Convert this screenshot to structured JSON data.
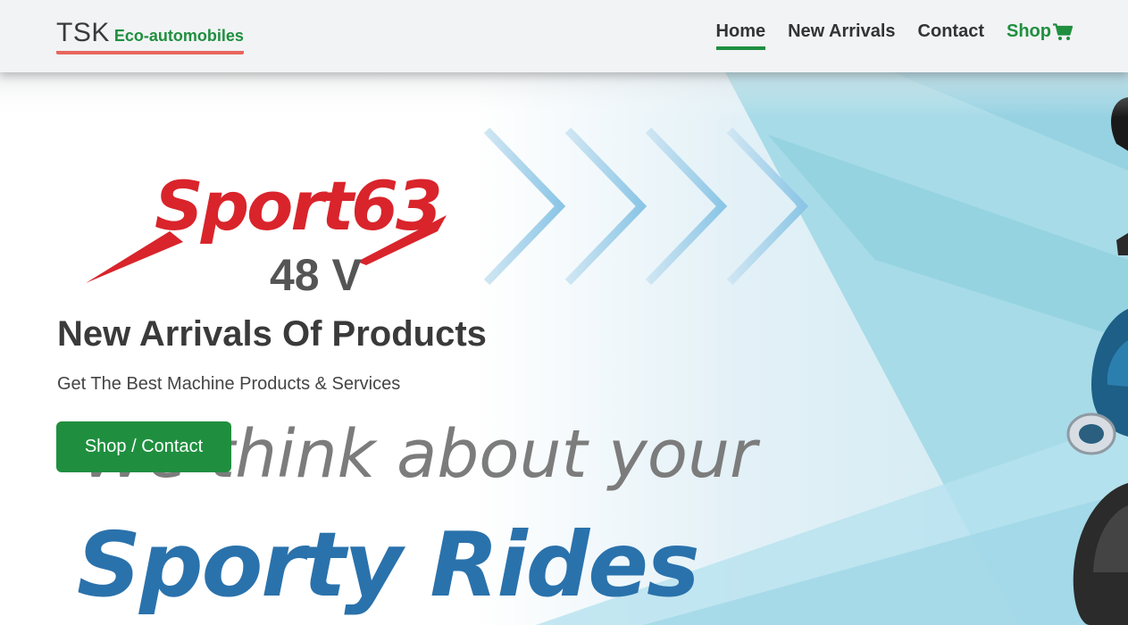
{
  "brand": {
    "name": "TSK",
    "tagline": "Eco-automobiles",
    "accent_underline": "#e8665e",
    "green": "#1f8f3f"
  },
  "nav": {
    "items": [
      {
        "label": "Home",
        "active": true
      },
      {
        "label": "New Arrivals",
        "active": false
      },
      {
        "label": "Contact",
        "active": false
      },
      {
        "label": "Shop",
        "active": false,
        "icon": "shopping-cart-icon"
      }
    ]
  },
  "hero": {
    "logo_text": "Sport63",
    "logo_sub": "48 V",
    "logo_color": "#d9242b",
    "slogan_line1": "We think about your",
    "slogan_line2": "Sporty Rides",
    "slogan_color": "#2a72ac",
    "title": "New Arrivals Of Products",
    "subtitle": "Get The Best Machine Products & Services",
    "cta_label": "Shop / Contact"
  }
}
